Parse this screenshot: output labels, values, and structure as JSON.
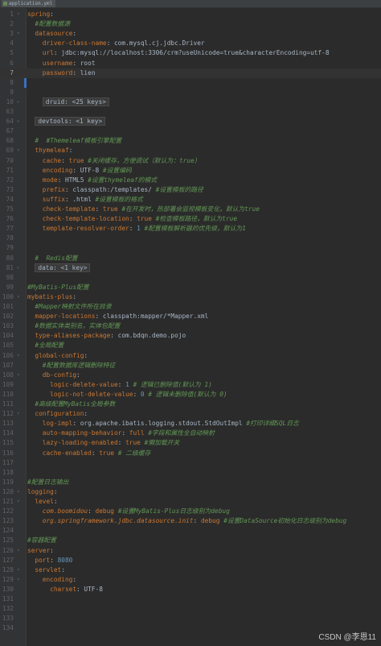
{
  "tab": {
    "label": "application.yml"
  },
  "watermark": "CSDN @李恩11",
  "lines": [
    {
      "n": "1",
      "t": "<span class='k'>spring</span>:"
    },
    {
      "n": "2",
      "t": "  <span class='c'>#配置数据源</span>"
    },
    {
      "n": "3",
      "t": "  <span class='k'>datasource</span>:"
    },
    {
      "n": "4",
      "t": "    <span class='k'>driver-class-name</span>: com.mysql.cj.jdbc.Driver"
    },
    {
      "n": "5",
      "t": "    <span class='k'>url</span>: jdbc:mysql://localhost:3306/crm?useUnicode=true&amp;characterEncoding=utf-8"
    },
    {
      "n": "6",
      "t": "    <span class='k'>username</span>: root"
    },
    {
      "n": "7",
      "t": "    <span class='k'>password</span>: lien",
      "current": true
    },
    {
      "n": "8",
      "t": ""
    },
    {
      "n": "9",
      "t": ""
    },
    {
      "n": "10",
      "t": "    <span class='folded'>druid: &lt;25 keys&gt;</span>"
    },
    {
      "n": "63",
      "t": ""
    },
    {
      "n": "64",
      "t": "  <span class='folded'>devtools: &lt;1 key&gt;</span>"
    },
    {
      "n": "67",
      "t": ""
    },
    {
      "n": "68",
      "t": "  <span class='c'>#  #Themeleaf模板引擎配置</span>"
    },
    {
      "n": "69",
      "t": "  <span class='k'>thymeleaf</span>:"
    },
    {
      "n": "70",
      "t": "    <span class='k'>cache</span>: <span class='k'>true</span> <span class='c'>#关闭缓存，方便调试（默认为：true）</span>"
    },
    {
      "n": "71",
      "t": "    <span class='k'>encoding</span>: UTF-8 <span class='c'>#设置编码</span>"
    },
    {
      "n": "72",
      "t": "    <span class='k'>mode</span>: HTML5 <span class='c'>#设置thymeleaf的模式</span>"
    },
    {
      "n": "73",
      "t": "    <span class='k'>prefix</span>: classpath:/templates/ <span class='c'>#设置模板的路径</span>"
    },
    {
      "n": "74",
      "t": "    <span class='k'>suffix</span>: .html <span class='c'>#设置模板的格式</span>"
    },
    {
      "n": "75",
      "t": "    <span class='k'>check-template</span>: <span class='k'>true</span> <span class='c'>#在开发时，热部署会监视模板变化，默认为true</span>"
    },
    {
      "n": "76",
      "t": "    <span class='k'>check-template-location</span>: <span class='k'>true</span> <span class='c'>#检查模板路径，默认为true</span>"
    },
    {
      "n": "77",
      "t": "    <span class='k'>template-resolver-order</span>: <span class='n'>1</span> <span class='c'>#配置模板解析器的优先级，默认为1</span>"
    },
    {
      "n": "78",
      "t": ""
    },
    {
      "n": "79",
      "t": ""
    },
    {
      "n": "80",
      "t": "  <span class='c'>#  Redis配置</span>"
    },
    {
      "n": "81",
      "t": "  <span class='folded'>data: &lt;1 key&gt;</span>"
    },
    {
      "n": "98",
      "t": ""
    },
    {
      "n": "99",
      "t": "<span class='c'>#MyBatis-Plus配置</span>"
    },
    {
      "n": "100",
      "t": "<span class='k'>mybatis-plus</span>:"
    },
    {
      "n": "101",
      "t": "  <span class='c'>#Mapper映射文件所在目录</span>"
    },
    {
      "n": "102",
      "t": "  <span class='k'>mapper-locations</span>: classpath:mapper/*Mapper.xml"
    },
    {
      "n": "103",
      "t": "  <span class='c'>#数据实体类别名，实体包配置</span>"
    },
    {
      "n": "104",
      "t": "  <span class='k'>type-aliases-package</span>: com.bdqn.demo.pojo"
    },
    {
      "n": "105",
      "t": "  <span class='c'>#全局配置</span>"
    },
    {
      "n": "106",
      "t": "  <span class='k'>global-config</span>:"
    },
    {
      "n": "107",
      "t": "    <span class='c'>#配置数据库逻辑删除特征</span>"
    },
    {
      "n": "108",
      "t": "    <span class='k'>db-config</span>:"
    },
    {
      "n": "109",
      "t": "      <span class='k'>logic-delete-value</span>: <span class='n'>1</span> <span class='c'># 逻辑已删除值(默认为 1)</span>"
    },
    {
      "n": "110",
      "t": "      <span class='k'>logic-not-delete-value</span>: <span class='n'>0</span> <span class='c'># 逻辑未删除值(默认为 0)</span>"
    },
    {
      "n": "111",
      "t": "  <span class='c'>#高级配置MyBatis全局参数</span>"
    },
    {
      "n": "112",
      "t": "  <span class='k'>configuration</span>:"
    },
    {
      "n": "113",
      "t": "    <span class='k'>log-impl</span>: org.apache.ibatis.logging.stdout.StdOutImpl <span class='c'>#打印详细SQL日志</span>"
    },
    {
      "n": "114",
      "t": "    <span class='k'>auto-mapping-behavior</span>: <span class='k'>full</span> <span class='c'>#字段和属性全自动映射</span>"
    },
    {
      "n": "115",
      "t": "    <span class='k'>lazy-loading-enabled</span>: <span class='k'>true</span> <span class='c'>#懒加载开关</span>"
    },
    {
      "n": "116",
      "t": "    <span class='k'>cache-enabled</span>: <span class='k'>true</span> <span class='c'># 二级缓存</span>"
    },
    {
      "n": "117",
      "t": ""
    },
    {
      "n": "118",
      "t": ""
    },
    {
      "n": "119",
      "t": "<span class='c'>#配置日志输出</span>"
    },
    {
      "n": "120",
      "t": "<span class='k'>logging</span>:"
    },
    {
      "n": "121",
      "t": "  <span class='k'>level</span>:"
    },
    {
      "n": "122",
      "t": "    <span class='k'><i>com.boomidou</i></span>: <span class='k'>debug</span> <span class='c'>#设置MyBatis-Plus日志级别为debug</span>"
    },
    {
      "n": "123",
      "t": "    <span class='k'><i>org.springframework.jdbc.datasource.init</i></span>: <span class='k'>debug</span> <span class='c'>#设置DataSource初始化日志级别为debug</span>"
    },
    {
      "n": "124",
      "t": ""
    },
    {
      "n": "125",
      "t": "<span class='c'>#容器配置</span>"
    },
    {
      "n": "126",
      "t": "<span class='k'>server</span>:"
    },
    {
      "n": "127",
      "t": "  <span class='k'>port</span>: <span class='n'>8080</span>"
    },
    {
      "n": "128",
      "t": "  <span class='k'>servlet</span>:"
    },
    {
      "n": "129",
      "t": "    <span class='k'>encoding</span>:"
    },
    {
      "n": "130",
      "t": "      <span class='k'>charset</span>: UTF-8"
    },
    {
      "n": "131",
      "t": ""
    },
    {
      "n": "132",
      "t": ""
    },
    {
      "n": "133",
      "t": ""
    },
    {
      "n": "134",
      "t": ""
    }
  ]
}
